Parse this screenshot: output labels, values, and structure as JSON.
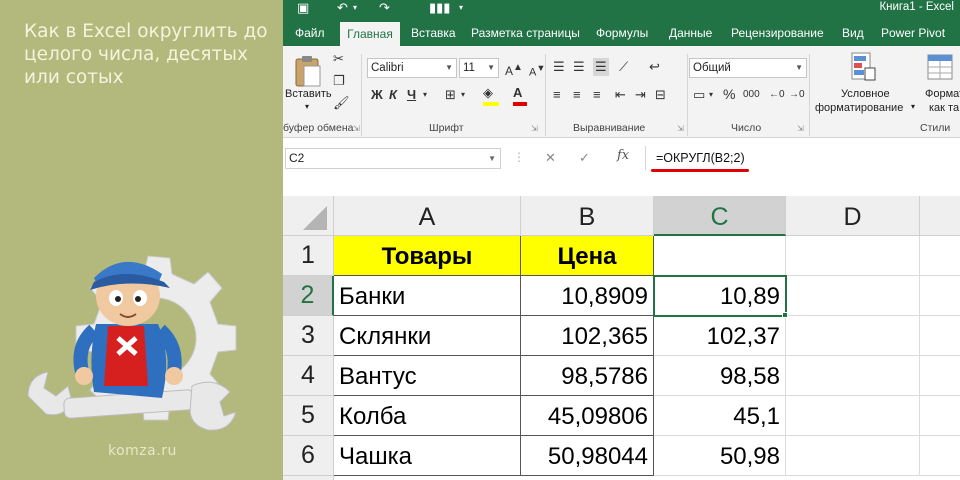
{
  "article": {
    "title": "Как в Excel округлить до целого числа, десятых или сотых",
    "site": "komza.ru"
  },
  "window": {
    "title": "Книга1 - Excel"
  },
  "ribbon": {
    "tabs": [
      {
        "label": "Файл"
      },
      {
        "label": "Главная"
      },
      {
        "label": "Вставка"
      },
      {
        "label": "Разметка страницы"
      },
      {
        "label": "Формулы"
      },
      {
        "label": "Данные"
      },
      {
        "label": "Рецензирование"
      },
      {
        "label": "Вид"
      },
      {
        "label": "Power Pivot"
      }
    ],
    "active_tab": "Главная",
    "paste_label": "Вставить",
    "font_name": "Calibri",
    "font_size": "11",
    "number_format": "Общий",
    "cond_format_line1": "Условное",
    "cond_format_line2": "форматирование",
    "format_as_table_line1": "Формати",
    "format_as_table_line2": "как та",
    "groups": {
      "clipboard": "буфер обмена",
      "font": "Шрифт",
      "alignment": "Выравнивание",
      "number": "Число",
      "styles": "Стили"
    },
    "bold": "Ж",
    "italic": "К",
    "underline": "Ч",
    "percent": "%",
    "thousands": "000"
  },
  "formula_bar": {
    "name_box": "C2",
    "formula": "=ОКРУГЛ(B2;2)"
  },
  "sheet": {
    "columns": [
      "A",
      "B",
      "C",
      "D"
    ],
    "rows": [
      "1",
      "2",
      "3",
      "4",
      "5",
      "6"
    ],
    "selected_column": "C",
    "selected_row": "2",
    "header": {
      "a": "Товары",
      "b": "Цена"
    },
    "data": [
      {
        "a": "Банки",
        "b": "10,8909",
        "c": "10,89"
      },
      {
        "a": "Склянки",
        "b": "102,365",
        "c": "102,37"
      },
      {
        "a": "Вантус",
        "b": "98,5786",
        "c": "98,58"
      },
      {
        "a": "Колба",
        "b": "45,09806",
        "c": "45,1"
      },
      {
        "a": "Чашка",
        "b": "50,98044",
        "c": "50,98"
      }
    ]
  },
  "colors": {
    "excel_green": "#217346",
    "panel_olive": "#b3b87d",
    "header_fill": "#ffff00",
    "formula_underline": "#e00000"
  }
}
